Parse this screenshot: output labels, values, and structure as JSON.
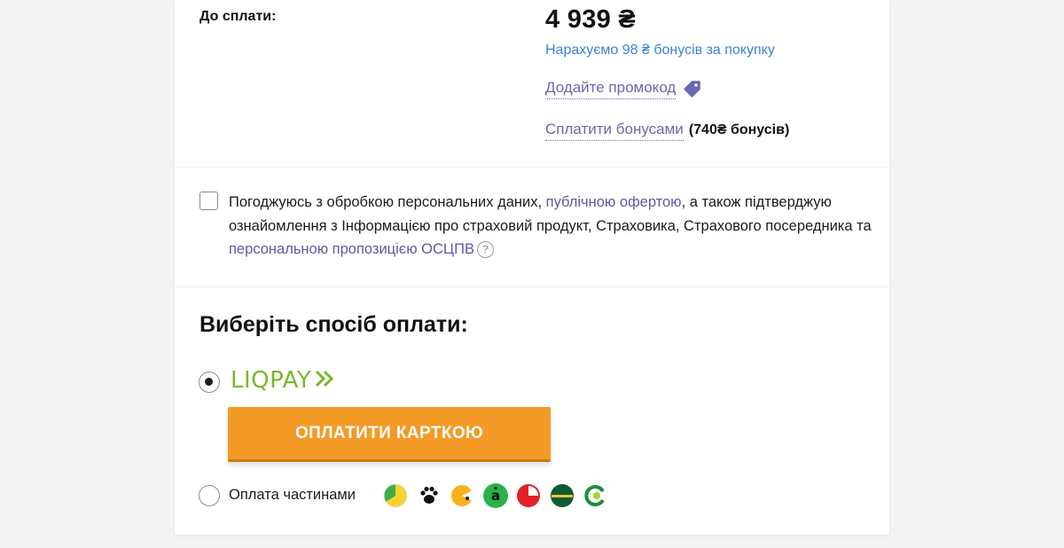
{
  "summary": {
    "due_label": "До сплати:",
    "amount": "4 939 ₴",
    "bonus_accrual": "Нарахуємо 98 ₴ бонусів за покупку",
    "promo_link": "Додайте промокод",
    "pay_bonuses_link": "Сплатити бонусами",
    "bonus_balance": "(740₴ бонусів)"
  },
  "consent": {
    "text_1": "Погоджуюсь з обробкою персональних даних, ",
    "link_offer": "публічною офертою",
    "text_2": ", а також підтверджую ознайомлення з Інформацією про страховий продукт, Страховика, Страхового посередника та ",
    "link_proposal": "персональною пропозицією ОСЦПВ",
    "help_icon": "?",
    "checked": false
  },
  "payment": {
    "title": "Виберіть спосіб оплати:",
    "liqpay_logo_text": "LIQPAY",
    "pay_button_label": "ОПЛАТИТИ КАРТКОЮ",
    "installments_label": "Оплата частинами",
    "selected": "liqpay"
  },
  "colors": {
    "link_blue": "#3b82d6",
    "link_purple": "#6a68ae",
    "button_orange": "#f49a26",
    "liqpay_green": "#7ab72b"
  },
  "icons": [
    "tag-icon",
    "help-icon",
    "liqpay-arrows-icon",
    "bank-icon-1",
    "bank-icon-paw",
    "bank-icon-3",
    "bank-icon-a",
    "bank-icon-pumb",
    "bank-icon-5",
    "bank-icon-6"
  ]
}
